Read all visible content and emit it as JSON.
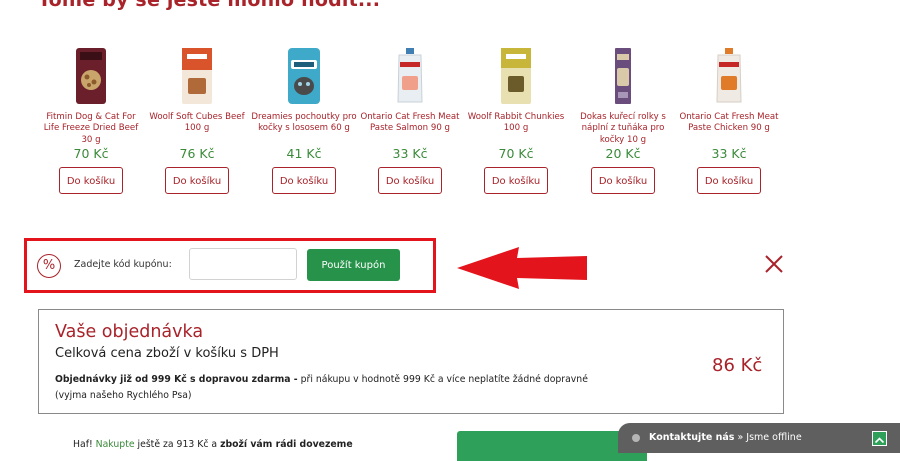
{
  "heading": "Tohle by se ještě mohlo hodit...",
  "products": [
    {
      "name": "Fitmin Dog & Cat For Life Freeze Dried Beef 30 g",
      "price": "70 Kč",
      "button": "Do košíku",
      "image": "fitmin-bag",
      "colors": [
        "#6b1f2a",
        "#3a1016"
      ]
    },
    {
      "name": "Woolf Soft Cubes Beef 100 g",
      "price": "76 Kč",
      "button": "Do košíku",
      "image": "woolf-bag",
      "colors": [
        "#d9542b",
        "#f2e7d8"
      ]
    },
    {
      "name": "Dreamies pochoutky pro kočky s lososem 60 g",
      "price": "41 Kč",
      "button": "Do košíku",
      "image": "dreamies-bag",
      "colors": [
        "#3fa9c9",
        "#1d5e7a"
      ]
    },
    {
      "name": "Ontario Cat Fresh Meat Paste Salmon 90 g",
      "price": "33 Kč",
      "button": "Do košíku",
      "image": "ontario-pouch",
      "colors": [
        "#e9eef2",
        "#3f7fb3"
      ]
    },
    {
      "name": "Woolf Rabbit Chunkies 100 g",
      "price": "70 Kč",
      "button": "Do košíku",
      "image": "woolf-rabbit-bag",
      "colors": [
        "#c7b63a",
        "#6b5a2a"
      ]
    },
    {
      "name": "Dokas kuřecí rolky s náplní z tuňáka pro kočky 10 g",
      "price": "20 Kč",
      "button": "Do košíku",
      "image": "dokas-pack",
      "colors": [
        "#6a4d7d",
        "#d9c9a8"
      ]
    },
    {
      "name": "Ontario Cat Fresh Meat Paste Chicken 90 g",
      "price": "33 Kč",
      "button": "Do košíku",
      "image": "ontario-chicken-pouch",
      "colors": [
        "#efeae4",
        "#e07b2a"
      ]
    }
  ],
  "coupon": {
    "icon": "percent-icon",
    "label": "Zadejte kód kupónu:",
    "placeholder": "",
    "button": "Použít kupón",
    "highlight_color": "#e3141c"
  },
  "close_icon": "close-icon",
  "order": {
    "title": "Vaše objednávka",
    "subtitle": "Celková cena zboží v košíku s DPH",
    "note_bold": "Objednávky již od 999 Kč s dopravou zdarma -",
    "note_text": " při nákupu v hodnotě 999 Kč a více neplatíte žádné dopravné",
    "note_line2": "(vyjma našeho Rychlého Psa)",
    "total": "86 Kč"
  },
  "hint": {
    "prefix": "Haf! ",
    "link": "Nakupte",
    "middle": " ještě za 913 Kč a ",
    "bold": "zboží vám rádi dovezeme"
  },
  "chat": {
    "title": "Kontaktujte nás",
    "separator": " » ",
    "status": "Jsme offline"
  },
  "colors": {
    "brand": "#a8232a",
    "price": "#3a8a3a",
    "primary_button": "#27934a"
  }
}
